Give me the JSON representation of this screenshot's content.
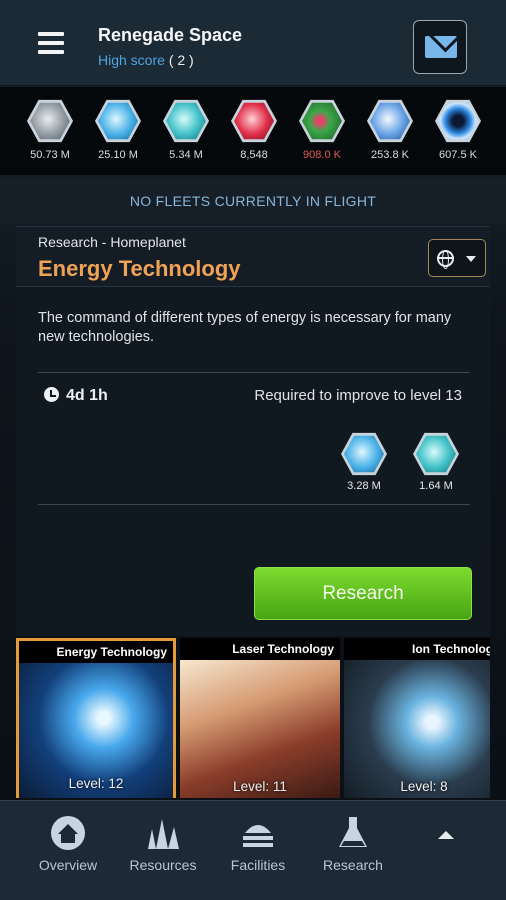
{
  "header": {
    "title": "Renegade Space",
    "high_score_label": "High score",
    "high_score_value": "( 2 )"
  },
  "resources": [
    {
      "icon": "metal-icon",
      "value": "50.73 M",
      "color": "#b9c1c8",
      "warn": false
    },
    {
      "icon": "crystal-icon",
      "value": "25.10 M",
      "color": "#5fc3ef",
      "warn": false
    },
    {
      "icon": "deuterium-icon",
      "value": "5.34 M",
      "color": "#5bd1d1",
      "warn": false
    },
    {
      "icon": "energy-icon",
      "value": "8,548",
      "color": "#e0304a",
      "warn": false
    },
    {
      "icon": "food-icon",
      "value": "908.0 K",
      "color": "#3da84a",
      "warn": true
    },
    {
      "icon": "population-icon",
      "value": "253.8 K",
      "color": "#6aa4e6",
      "warn": false
    },
    {
      "icon": "dark-matter-icon",
      "value": "607.5 K",
      "color": "#2a86e0",
      "warn": false
    }
  ],
  "fleets_status": "NO FLEETS CURRENTLY IN FLIGHT",
  "panel": {
    "subtitle": "Research - Homeplanet",
    "title": "Energy Technology",
    "description": "The command of different types of energy is necessary for many new technologies.",
    "duration": "4d 1h",
    "requirement": "Required to improve to level 13",
    "costs": [
      {
        "icon": "crystal-icon",
        "value": "3.28 M"
      },
      {
        "icon": "deuterium-icon",
        "value": "1.64 M"
      }
    ],
    "action_label": "Research"
  },
  "cards": [
    {
      "title": "Energy Technology",
      "level": "Level: 12",
      "selected": true
    },
    {
      "title": "Laser Technology",
      "level": "Level: 11",
      "selected": false
    },
    {
      "title": "Ion Technology",
      "level": "Level: 8",
      "selected": false
    }
  ],
  "nav": [
    {
      "icon": "home-icon",
      "label": "Overview"
    },
    {
      "icon": "crystals-icon",
      "label": "Resources"
    },
    {
      "icon": "facilities-icon",
      "label": "Facilities"
    },
    {
      "icon": "flask-icon",
      "label": "Research"
    }
  ],
  "colors": {
    "accent_orange": "#f0a255",
    "link_blue": "#4fa3e0",
    "button_green": "#5fc01f"
  }
}
